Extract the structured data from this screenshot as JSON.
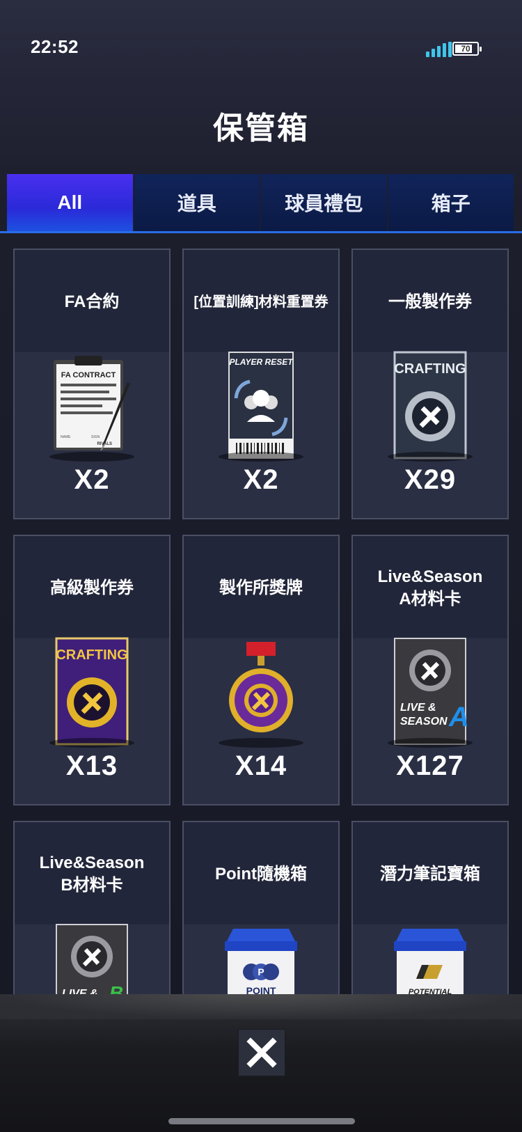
{
  "status_bar": {
    "time": "22:52",
    "battery": "70"
  },
  "header": {
    "title": "保管箱"
  },
  "tabs": [
    {
      "label": "All",
      "active": true
    },
    {
      "label": "道具",
      "active": false
    },
    {
      "label": "球員禮包",
      "active": false
    },
    {
      "label": "箱子",
      "active": false
    }
  ],
  "items": [
    {
      "name": "FA合約",
      "qty": "X2",
      "icon": "fa-contract-icon",
      "icon_text": [
        "FA CONTRACT",
        "NAME",
        "SIGN",
        "RIVALS"
      ]
    },
    {
      "name": "[位置訓練]材料重置券",
      "qty": "X2",
      "icon": "player-reset-ticket-icon",
      "icon_text": [
        "PLAYER RESET"
      ]
    },
    {
      "name": "一般製作券",
      "qty": "X29",
      "icon": "crafting-ticket-icon",
      "icon_text": [
        "CRAFTING"
      ]
    },
    {
      "name": "高級製作券",
      "qty": "X13",
      "icon": "premium-crafting-ticket-icon",
      "icon_text": [
        "CRAFTING"
      ]
    },
    {
      "name": "製作所獎牌",
      "qty": "X14",
      "icon": "workshop-medal-icon",
      "icon_text": []
    },
    {
      "name": "Live&Season\nA材料卡",
      "qty": "X127",
      "icon": "live-season-a-card-icon",
      "icon_text": [
        "LIVE &",
        "SEASON",
        "A"
      ]
    },
    {
      "name": "Live&Season\nB材料卡",
      "qty": "",
      "icon": "live-season-b-card-icon",
      "icon_text": [
        "LIVE &",
        "B"
      ]
    },
    {
      "name": "Point隨機箱",
      "qty": "",
      "icon": "point-random-box-icon",
      "icon_text": [
        "P",
        "POINT"
      ]
    },
    {
      "name": "潛力筆記寶箱",
      "qty": "",
      "icon": "potential-note-box-icon",
      "icon_text": [
        "POTENTIAL"
      ]
    }
  ],
  "colors": {
    "tab_active": "#3a2ee8",
    "tab_inactive": "#0f2152",
    "accent_line": "#2a6de6"
  }
}
